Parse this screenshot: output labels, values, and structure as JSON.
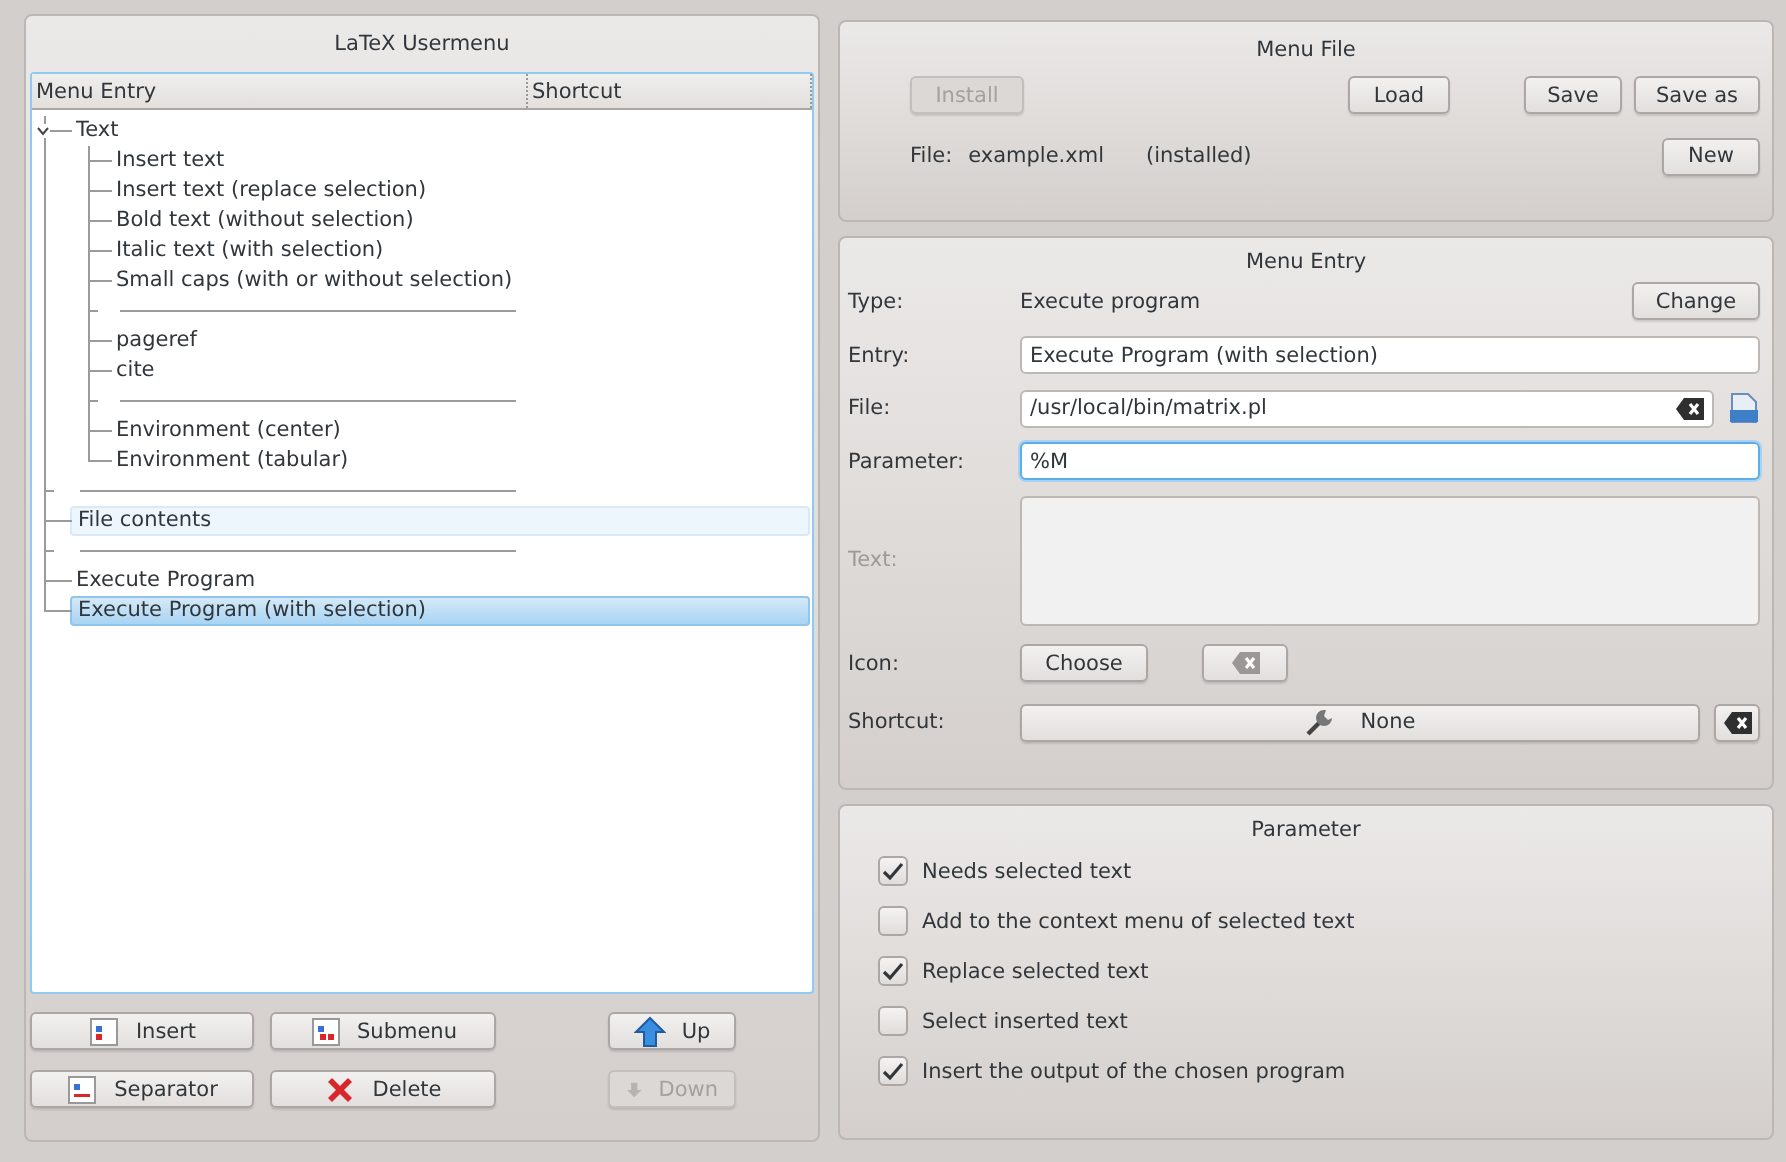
{
  "left_panel": {
    "title": "LaTeX Usermenu",
    "columns": [
      "Menu Entry",
      "Shortcut"
    ],
    "tree": [
      {
        "kind": "entry",
        "label": "Text",
        "expanded": true,
        "selected": false,
        "highlighted": false,
        "children": [
          {
            "kind": "entry",
            "label": "Insert text",
            "selected": false,
            "highlighted": false
          },
          {
            "kind": "entry",
            "label": "Insert text (replace selection)",
            "selected": false,
            "highlighted": false
          },
          {
            "kind": "entry",
            "label": "Bold text (without selection)",
            "selected": false,
            "highlighted": false
          },
          {
            "kind": "entry",
            "label": "Italic text (with selection)",
            "selected": false,
            "highlighted": false
          },
          {
            "kind": "entry",
            "label": "Small caps (with or without selection)",
            "selected": false,
            "highlighted": false
          },
          {
            "kind": "separator"
          },
          {
            "kind": "entry",
            "label": "pageref",
            "selected": false,
            "highlighted": false
          },
          {
            "kind": "entry",
            "label": "cite",
            "selected": false,
            "highlighted": false
          },
          {
            "kind": "separator"
          },
          {
            "kind": "entry",
            "label": "Environment (center)",
            "selected": false,
            "highlighted": false
          },
          {
            "kind": "entry",
            "label": "Environment (tabular)",
            "selected": false,
            "highlighted": false
          }
        ]
      },
      {
        "kind": "separator"
      },
      {
        "kind": "entry",
        "label": "File contents",
        "selected": false,
        "highlighted": true
      },
      {
        "kind": "separator"
      },
      {
        "kind": "entry",
        "label": "Execute Program",
        "selected": false,
        "highlighted": false
      },
      {
        "kind": "entry",
        "label": "Execute Program (with selection)",
        "selected": true,
        "highlighted": false
      }
    ],
    "buttons": [
      {
        "kind": "insert",
        "label": "Insert",
        "disabled": false
      },
      {
        "kind": "submenu",
        "label": "Submenu",
        "disabled": false
      },
      {
        "kind": "up",
        "label": "Up",
        "disabled": false
      },
      {
        "kind": "separator",
        "label": "Separator",
        "disabled": false
      },
      {
        "kind": "delete",
        "label": "Delete",
        "disabled": false
      },
      {
        "kind": "down",
        "label": "Down",
        "disabled": true
      }
    ]
  },
  "menu_file": {
    "title": "Menu File",
    "buttons": [
      {
        "label": "Install",
        "disabled": true
      },
      {
        "label": "Load",
        "disabled": false
      },
      {
        "label": "Save",
        "disabled": false
      },
      {
        "label": "Save as",
        "disabled": false
      }
    ],
    "file_label": "File:",
    "file_name": "example.xml",
    "file_status": "(installed)",
    "new_button": "New"
  },
  "menu_entry": {
    "title": "Menu Entry",
    "type_label": "Type:",
    "type_value": "Execute program",
    "change_button": "Change",
    "fields": [
      {
        "kind": "text",
        "label": "Entry:",
        "value": "Execute Program (with selection)",
        "focused": false
      },
      {
        "kind": "file",
        "label": "File:",
        "value": "/usr/local/bin/matrix.pl",
        "focused": false
      },
      {
        "kind": "text",
        "label": "Parameter:",
        "value": "%M",
        "focused": true
      },
      {
        "kind": "multiline",
        "label": "Text:",
        "disabled": true
      },
      {
        "kind": "icon",
        "label": "Icon:",
        "button": "Choose"
      },
      {
        "kind": "shortcut",
        "label": "Shortcut:",
        "button": "None"
      }
    ]
  },
  "parameter": {
    "title": "Parameter",
    "options": [
      {
        "label": "Needs selected text",
        "checked": true
      },
      {
        "label": "Add to the context menu of selected text",
        "checked": false
      },
      {
        "label": "Replace selected text",
        "checked": true
      },
      {
        "label": "Select inserted text",
        "checked": false
      },
      {
        "label": "Insert the output of the chosen program",
        "checked": true
      }
    ]
  }
}
